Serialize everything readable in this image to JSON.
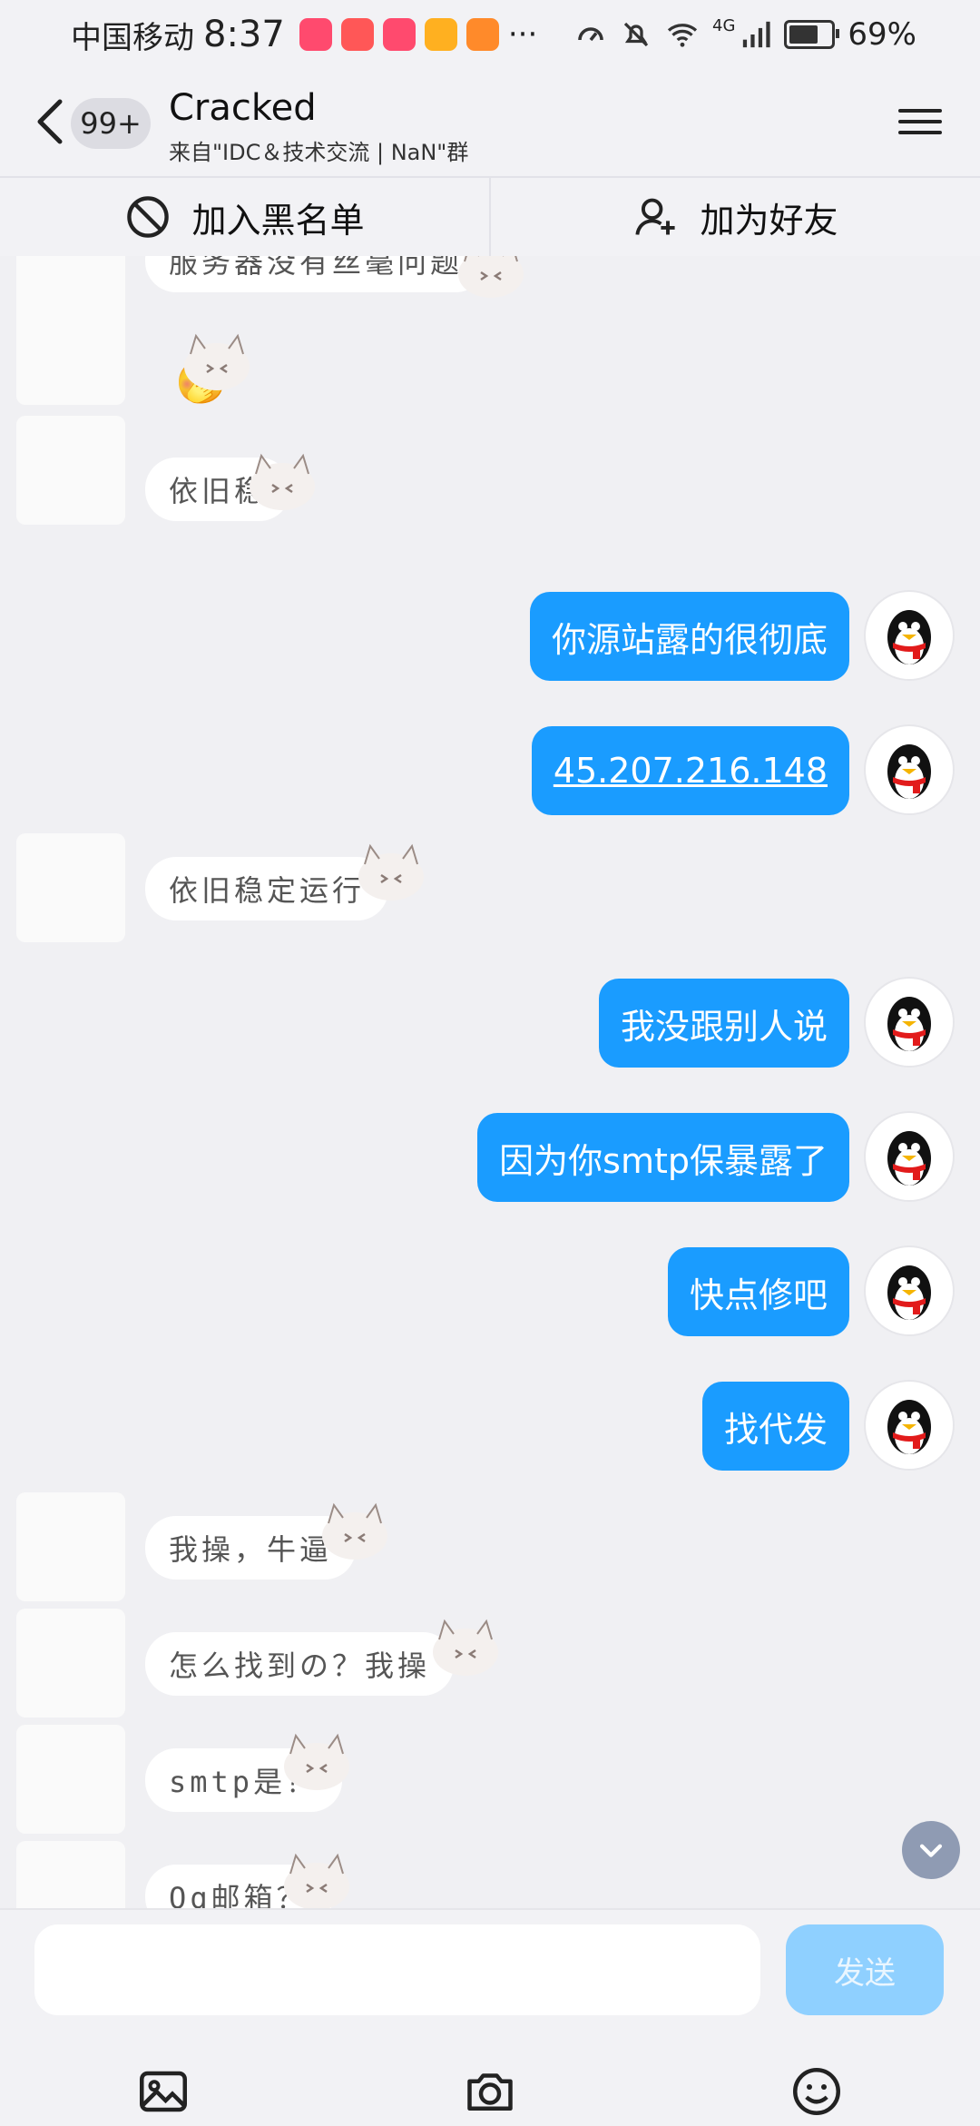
{
  "status_bar": {
    "carrier": "中国移动",
    "time": "8:37",
    "dots": "···",
    "battery": "69%",
    "network": "4G",
    "app_icon_colors": [
      "#ff4a6e",
      "#ff5757",
      "#ff4a6e",
      "#ffb020",
      "#ff8a2a"
    ]
  },
  "header": {
    "unread_badge": "99+",
    "title": "Cracked",
    "subtitle": "来自\"IDC＆技术交流 | NaN\"群"
  },
  "actions": {
    "blacklist": "加入黑名单",
    "add_friend": "加为好友"
  },
  "messages": [
    {
      "side": "other",
      "text": "服务器没有丝毫问题"
    },
    {
      "side": "other",
      "text": "🤭"
    },
    {
      "side": "other",
      "text": "依旧稳"
    },
    {
      "side": "me",
      "text": "你源站露的很彻底"
    },
    {
      "side": "me",
      "text": "45.207.216.148"
    },
    {
      "side": "other",
      "text": "依旧稳定运行"
    },
    {
      "side": "me",
      "text": "我没跟别人说"
    },
    {
      "side": "me",
      "text": "因为你smtp保暴露了"
    },
    {
      "side": "me",
      "text": "快点修吧"
    },
    {
      "side": "me",
      "text": "找代发"
    },
    {
      "side": "other",
      "text": "我操，牛逼"
    },
    {
      "side": "other",
      "text": "怎么找到の？我操"
    },
    {
      "side": "other",
      "text": "smtp是？"
    },
    {
      "side": "other",
      "text": "Qq邮箱？"
    }
  ],
  "input": {
    "placeholder": "",
    "send_label": "发送"
  },
  "colors": {
    "my_bubble": "#1a9cff",
    "send_disabled": "#8fd0ff",
    "background": "#f0f0f3"
  },
  "icons": {
    "back": "chevron-left-icon",
    "menu": "hamburger-menu-icon",
    "blacklist": "block-icon",
    "add_friend": "add-user-icon",
    "scroll_down": "chevron-down-icon",
    "image": "image-icon",
    "camera": "camera-icon",
    "emoji": "emoji-icon"
  }
}
